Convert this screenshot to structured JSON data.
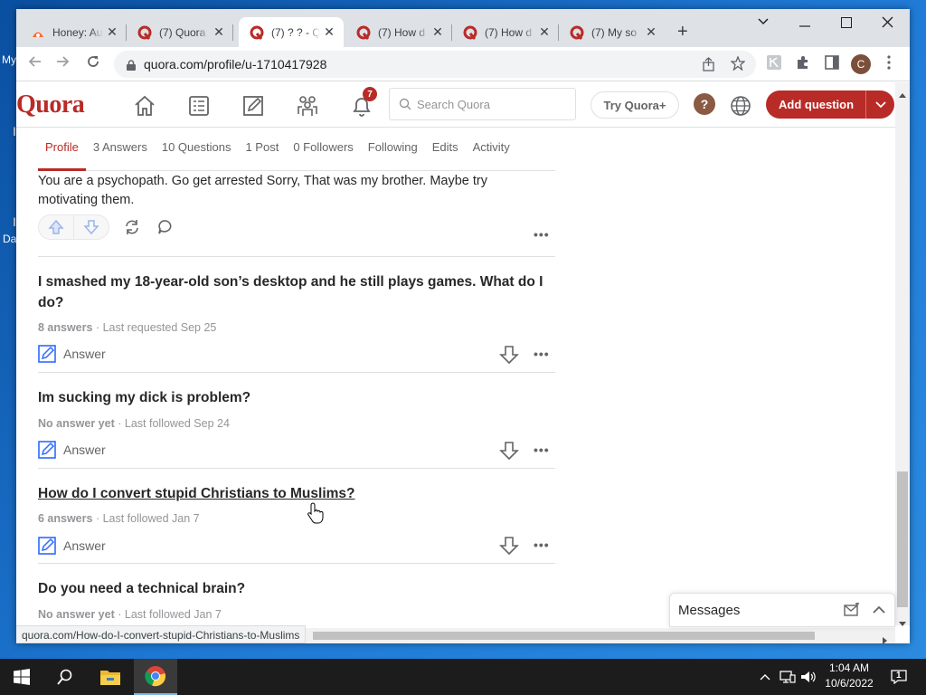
{
  "desktop": {
    "icon_labels": [
      "My",
      "I",
      "Da"
    ]
  },
  "browser": {
    "tabs": [
      {
        "title": "Honey: Au",
        "active": false
      },
      {
        "title": "(7) Quora",
        "active": false
      },
      {
        "title": "(7) ? ? - Q",
        "active": true
      },
      {
        "title": "(7) How d",
        "active": false
      },
      {
        "title": "(7) How d",
        "active": false
      },
      {
        "title": "(7) My so",
        "active": false
      }
    ],
    "url": "quora.com/profile/u-1710417928",
    "profile_initial": "C",
    "status_url": "quora.com/How-do-I-convert-stupid-Christians-to-Muslims"
  },
  "quora": {
    "logo": "Quora",
    "notification_count": "7",
    "search_placeholder": "Search Quora",
    "try_plus": "Try Quora+",
    "add_question": "Add question",
    "profile_tabs": [
      "Profile",
      "3 Answers",
      "10 Questions",
      "1 Post",
      "0 Followers",
      "Following",
      "Edits",
      "Activity"
    ],
    "answer_text": "You are a psychopath. Go get arrested Sorry, That was my brother. Maybe try motivating them.",
    "answer_label": "Answer",
    "more_label": "•••",
    "questions": [
      {
        "title": "I smashed my 18-year-old son’s desktop and he still plays games. What do I do?",
        "count": "8 answers",
        "meta": " · Last requested Sep 25"
      },
      {
        "title": "Im sucking my dick is problem?",
        "count": "No answer yet",
        "meta": " · Last followed Sep 24"
      },
      {
        "title": "How do I convert stupid Christians to Muslims?",
        "count": "6 answers",
        "meta": " · Last followed Jan 7",
        "hovered": true
      },
      {
        "title": "Do you need a technical brain?",
        "count": "No answer yet",
        "meta": " · Last followed Jan 7"
      }
    ],
    "messages_label": "Messages"
  },
  "taskbar": {
    "time": "1:04 AM",
    "date": "10/6/2022",
    "notification_count": "1"
  },
  "colors": {
    "brand": "#b92b27",
    "tab_strip": "#dee1e6",
    "taskbar": "#1c1c1c"
  }
}
